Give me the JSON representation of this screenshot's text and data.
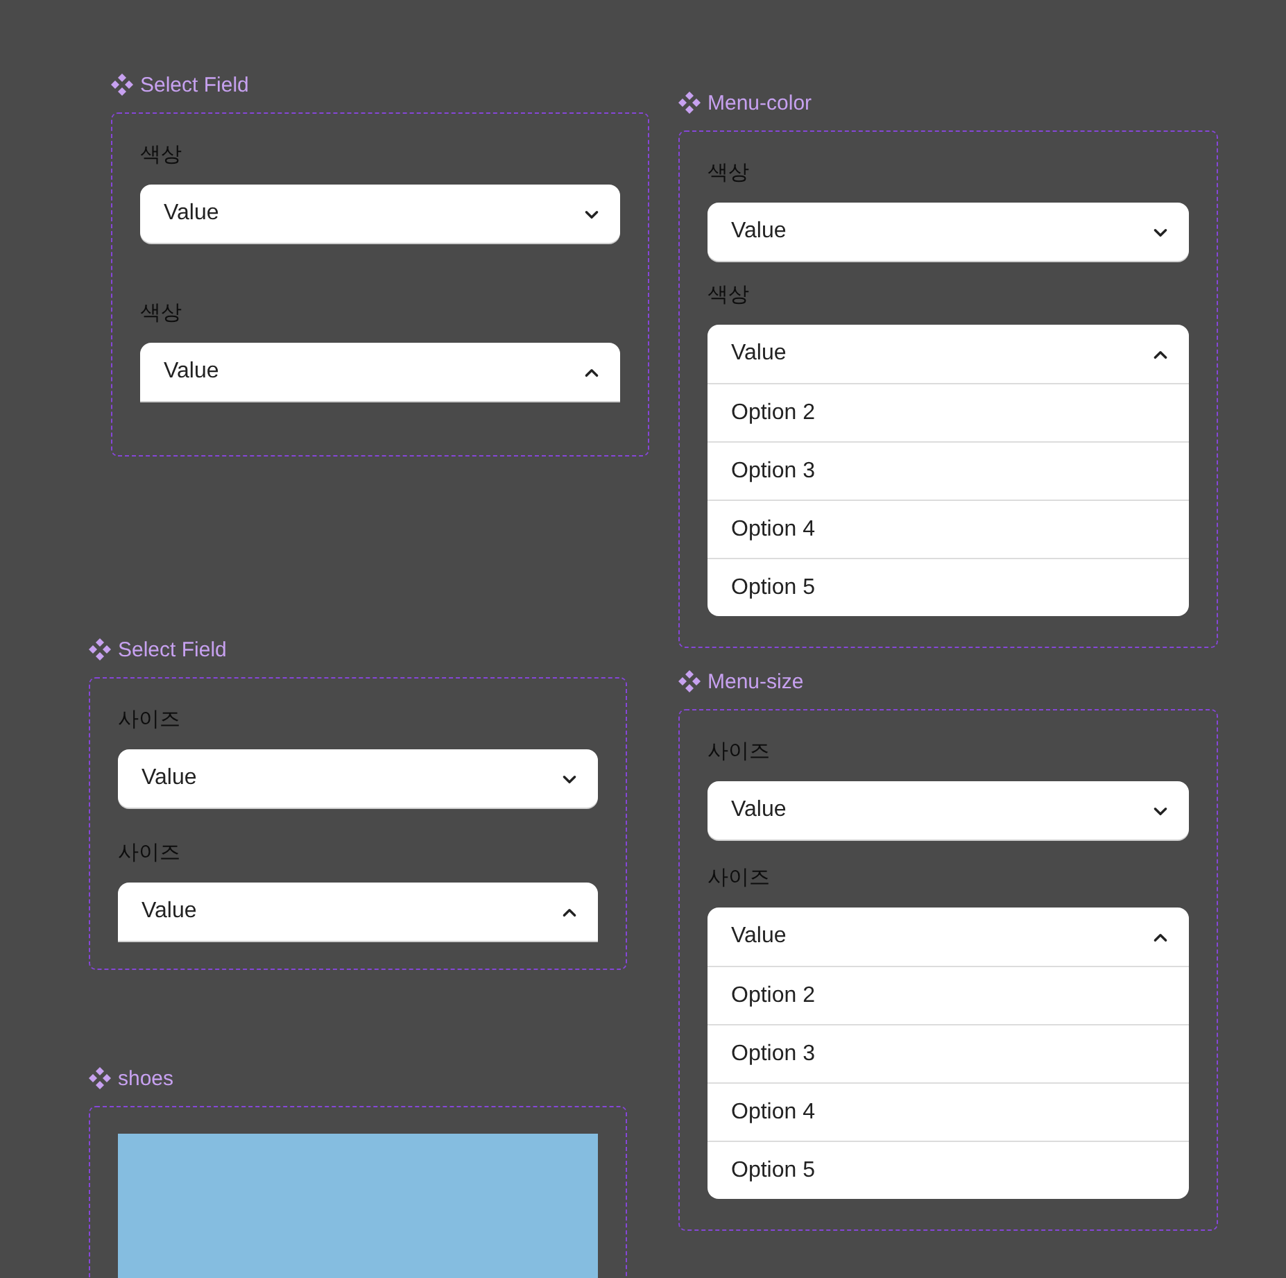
{
  "component_sets": [
    {
      "title": "Select Field",
      "kind": "fields",
      "fields": [
        {
          "label": "색상",
          "value": "Value",
          "expanded": false
        },
        {
          "label": "색상",
          "value": "Value",
          "expanded": true
        }
      ]
    },
    {
      "title": "Menu-color",
      "kind": "fields",
      "fields": [
        {
          "label": "색상",
          "value": "Value",
          "expanded": false
        },
        {
          "label": "색상",
          "value": "Value",
          "expanded": true,
          "options": [
            "Option 2",
            "Option 3",
            "Option 4",
            "Option 5"
          ]
        }
      ]
    },
    {
      "title": "Select Field",
      "kind": "fields",
      "fields": [
        {
          "label": "사이즈",
          "value": "Value",
          "expanded": false
        },
        {
          "label": "사이즈",
          "value": "Value",
          "expanded": true
        }
      ]
    },
    {
      "title": "Menu-size",
      "kind": "fields",
      "fields": [
        {
          "label": "사이즈",
          "value": "Value",
          "expanded": false
        },
        {
          "label": "사이즈",
          "value": "Value",
          "expanded": true,
          "options": [
            "Option 2",
            "Option 3",
            "Option 4",
            "Option 5"
          ]
        }
      ]
    },
    {
      "title": "shoes",
      "kind": "image"
    }
  ]
}
